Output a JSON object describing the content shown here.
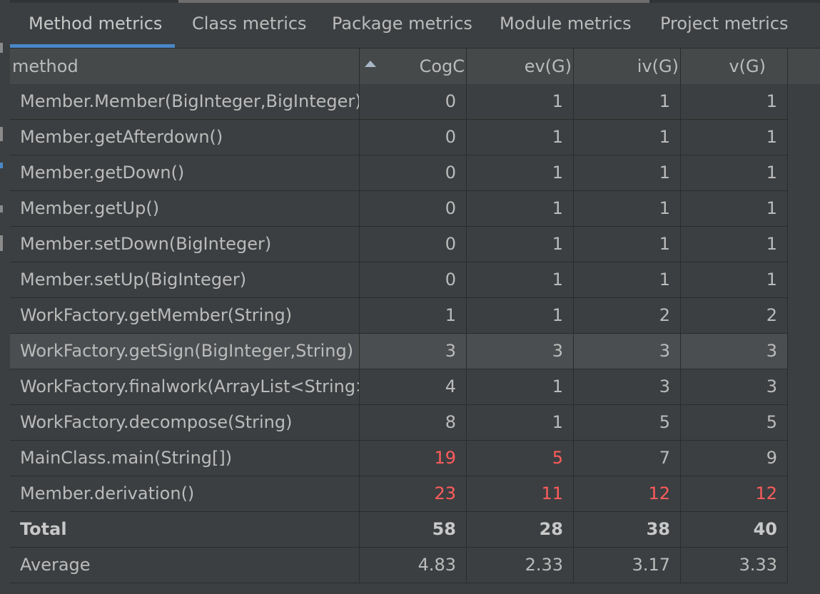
{
  "tabs": [
    {
      "label": "Method metrics",
      "active": true
    },
    {
      "label": "Class metrics",
      "active": false
    },
    {
      "label": "Package metrics",
      "active": false
    },
    {
      "label": "Module metrics",
      "active": false
    },
    {
      "label": "Project metrics",
      "active": false
    }
  ],
  "columns": [
    "method",
    "CogC",
    "ev(G)",
    "iv(G)",
    "v(G)"
  ],
  "sort": {
    "column": "CogC",
    "direction": "ascending"
  },
  "rows": [
    {
      "method": "Member.Member(BigInteger,BigInteger)",
      "cogc": "0",
      "evg": "1",
      "ivg": "1",
      "vg": "1"
    },
    {
      "method": "Member.getAfterdown()",
      "cogc": "0",
      "evg": "1",
      "ivg": "1",
      "vg": "1"
    },
    {
      "method": "Member.getDown()",
      "cogc": "0",
      "evg": "1",
      "ivg": "1",
      "vg": "1"
    },
    {
      "method": "Member.getUp()",
      "cogc": "0",
      "evg": "1",
      "ivg": "1",
      "vg": "1"
    },
    {
      "method": "Member.setDown(BigInteger)",
      "cogc": "0",
      "evg": "1",
      "ivg": "1",
      "vg": "1"
    },
    {
      "method": "Member.setUp(BigInteger)",
      "cogc": "0",
      "evg": "1",
      "ivg": "1",
      "vg": "1"
    },
    {
      "method": "WorkFactory.getMember(String)",
      "cogc": "1",
      "evg": "1",
      "ivg": "2",
      "vg": "2"
    },
    {
      "method": "WorkFactory.getSign(BigInteger,String)",
      "cogc": "3",
      "evg": "3",
      "ivg": "3",
      "vg": "3",
      "selected": true
    },
    {
      "method": "WorkFactory.finalwork(ArrayList<String>)",
      "cogc": "4",
      "evg": "1",
      "ivg": "3",
      "vg": "3"
    },
    {
      "method": "WorkFactory.decompose(String)",
      "cogc": "8",
      "evg": "1",
      "ivg": "5",
      "vg": "5"
    },
    {
      "method": "MainClass.main(String[])",
      "cogc": "19",
      "evg": "5",
      "ivg": "7",
      "vg": "9",
      "red": [
        "cogc",
        "evg"
      ]
    },
    {
      "method": "Member.derivation()",
      "cogc": "23",
      "evg": "11",
      "ivg": "12",
      "vg": "12",
      "red": [
        "cogc",
        "evg",
        "ivg",
        "vg"
      ]
    }
  ],
  "total": {
    "label": "Total",
    "cogc": "58",
    "evg": "28",
    "ivg": "38",
    "vg": "40"
  },
  "average": {
    "label": "Average",
    "cogc": "4.83",
    "evg": "2.33",
    "ivg": "3.17",
    "vg": "3.33"
  },
  "colors": {
    "warning": "#ff5c5c",
    "accent": "#4a88c7",
    "selection": "#4b4e50"
  }
}
